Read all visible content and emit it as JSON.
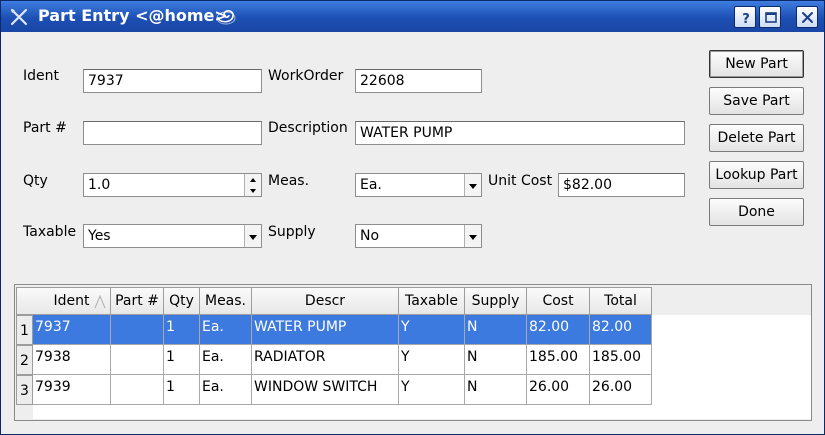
{
  "window": {
    "title": "Part Entry <@home>",
    "accent": "#1d4fb4",
    "buttons": [
      "help-icon",
      "maximize-icon",
      "close-icon"
    ]
  },
  "form": {
    "ident": {
      "label": "Ident",
      "value": "7937"
    },
    "workorder": {
      "label": "WorkOrder",
      "value": "22608"
    },
    "partnum": {
      "label": "Part #",
      "value": ""
    },
    "description": {
      "label": "Description",
      "value": "WATER PUMP"
    },
    "qty": {
      "label": "Qty",
      "value": "1.0"
    },
    "meas": {
      "label": "Meas.",
      "value": "Ea."
    },
    "unitcost": {
      "label": "Unit Cost",
      "value": "$82.00"
    },
    "taxable": {
      "label": "Taxable",
      "value": "Yes"
    },
    "supply": {
      "label": "Supply",
      "value": "No"
    }
  },
  "actions": {
    "new_part": "New Part",
    "save_part": "Save Part",
    "delete_part": "Delete Part",
    "lookup_part": "Lookup Part",
    "done": "Done"
  },
  "table": {
    "columns": [
      "Ident",
      "Part #",
      "Qty",
      "Meas.",
      "Descr",
      "Taxable",
      "Supply",
      "Cost",
      "Total"
    ],
    "sorted_column": "Ident",
    "selected_row": 1,
    "selection_color": "#3d7ae0",
    "rows": [
      {
        "n": "1",
        "cells": [
          "7937",
          "",
          "1",
          "Ea.",
          "WATER PUMP",
          "Y",
          "N",
          "82.00",
          "82.00"
        ]
      },
      {
        "n": "2",
        "cells": [
          "7938",
          "",
          "1",
          "Ea.",
          "RADIATOR",
          "Y",
          "N",
          "185.00",
          "185.00"
        ]
      },
      {
        "n": "3",
        "cells": [
          "7939",
          "",
          "1",
          "Ea.",
          "WINDOW SWITCH",
          "Y",
          "N",
          "26.00",
          "26.00"
        ]
      }
    ]
  }
}
